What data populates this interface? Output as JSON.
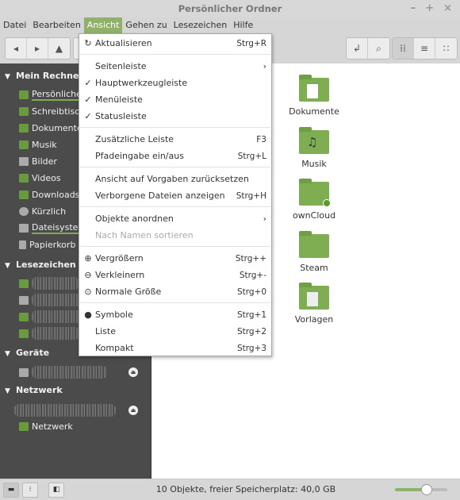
{
  "window": {
    "title": "Persönlicher Ordner",
    "controls": [
      "–",
      "+",
      "×"
    ]
  },
  "menubar": [
    "Datei",
    "Bearbeiten",
    "Ansicht",
    "Gehen zu",
    "Lesezeichen",
    "Hilfe"
  ],
  "accent": "#8fb16b",
  "sidebar": {
    "sections": [
      {
        "title": "Mein Rechner",
        "items": [
          "Persönlicher Ordner",
          "Schreibtisch",
          "Dokumente",
          "Musik",
          "Bilder",
          "Videos",
          "Downloads",
          "Kürzlich",
          "Dateisystem",
          "Papierkorb"
        ]
      },
      {
        "title": "Lesezeichen"
      },
      {
        "title": "Geräte"
      },
      {
        "title": "Netzwerk",
        "items": [
          "Netzwerk"
        ]
      }
    ],
    "visible": {
      "persoenlich": "Persönlicher"
    }
  },
  "folders": [
    "Dokumente",
    "Musik",
    "ownCloud",
    "Steam",
    "Vorlagen"
  ],
  "menu": [
    {
      "label": "Aktualisieren",
      "shortcut": "Strg+R",
      "mark": "↻"
    },
    {
      "label": "Seitenleiste",
      "shortcut": "›"
    },
    {
      "label": "Hauptwerkzeugleiste",
      "mark": "✓"
    },
    {
      "label": "Menüleiste",
      "mark": "✓"
    },
    {
      "label": "Statusleiste",
      "mark": "✓"
    },
    {
      "label": "Zusätzliche Leiste",
      "shortcut": "F3"
    },
    {
      "label": "Pfadeingabe ein/aus",
      "shortcut": "Strg+L"
    },
    {
      "label": "Ansicht auf Vorgaben zurücksetzen"
    },
    {
      "label": "Verborgene Dateien anzeigen",
      "shortcut": "Strg+H"
    },
    {
      "label": "Objekte anordnen",
      "shortcut": "›"
    },
    {
      "label": "Nach Namen sortieren",
      "disabled": true
    },
    {
      "label": "Vergrößern",
      "shortcut": "Strg++",
      "mark": "⊕"
    },
    {
      "label": "Verkleinern",
      "shortcut": "Strg+-",
      "mark": "⊖"
    },
    {
      "label": "Normale Größe",
      "shortcut": "Strg+0",
      "mark": "⊙"
    },
    {
      "label": "Symbole",
      "shortcut": "Strg+1",
      "mark": "●"
    },
    {
      "label": "Liste",
      "shortcut": "Strg+2"
    },
    {
      "label": "Kompakt",
      "shortcut": "Strg+3"
    }
  ],
  "statusbar": {
    "text": "10 Objekte, freier Speicherplatz: 40,0 GB",
    "zoom_level": 0.6
  }
}
